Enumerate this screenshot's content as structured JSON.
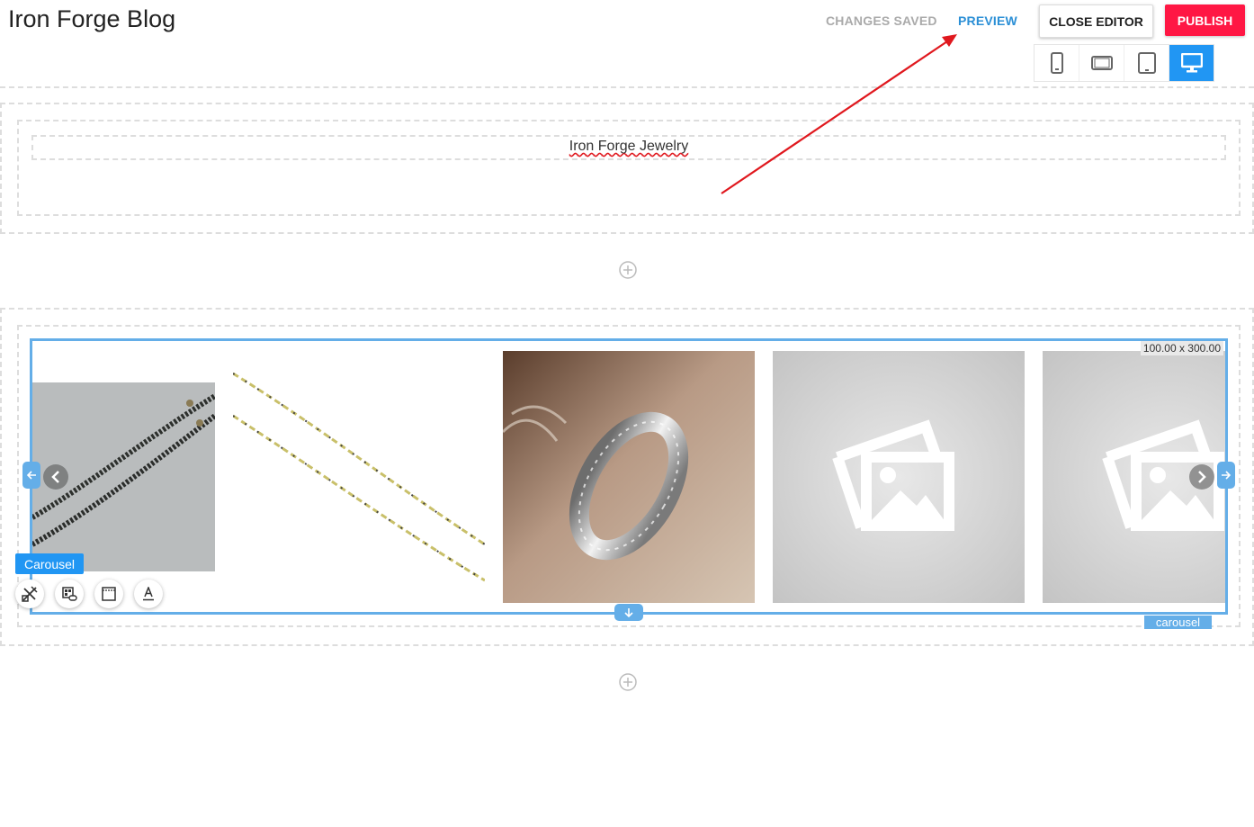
{
  "header": {
    "title": "Iron Forge Blog",
    "status": "CHANGES SAVED",
    "preview": "PREVIEW",
    "close_editor": "CLOSE EDITOR",
    "publish": "PUBLISH"
  },
  "devices": [
    {
      "icon": "phone-portrait-icon"
    },
    {
      "icon": "phone-landscape-icon"
    },
    {
      "icon": "tablet-icon"
    },
    {
      "icon": "desktop-icon",
      "active": true
    }
  ],
  "sections": {
    "headline_text": "Iron Forge Jewelry"
  },
  "carousel": {
    "dimensions": "100.00 x 300.00",
    "component_label": "Carousel",
    "type_tag": "carousel",
    "slides": [
      {
        "image": "black-beaded-chains"
      },
      {
        "image": "gold-and-black-chains"
      },
      {
        "image": "hammered-silver-ring"
      },
      {
        "image": "placeholder-image"
      },
      {
        "image": "placeholder-image"
      }
    ],
    "tools": [
      "design-tools-icon",
      "linked-gallery-icon",
      "frame-icon",
      "text-style-icon"
    ]
  },
  "colors": {
    "accent": "#2196f3",
    "publish": "#ff1744",
    "preview_link": "#2b8fd6",
    "selection": "#64aee8",
    "annotation_arrow": "#e0181e"
  }
}
